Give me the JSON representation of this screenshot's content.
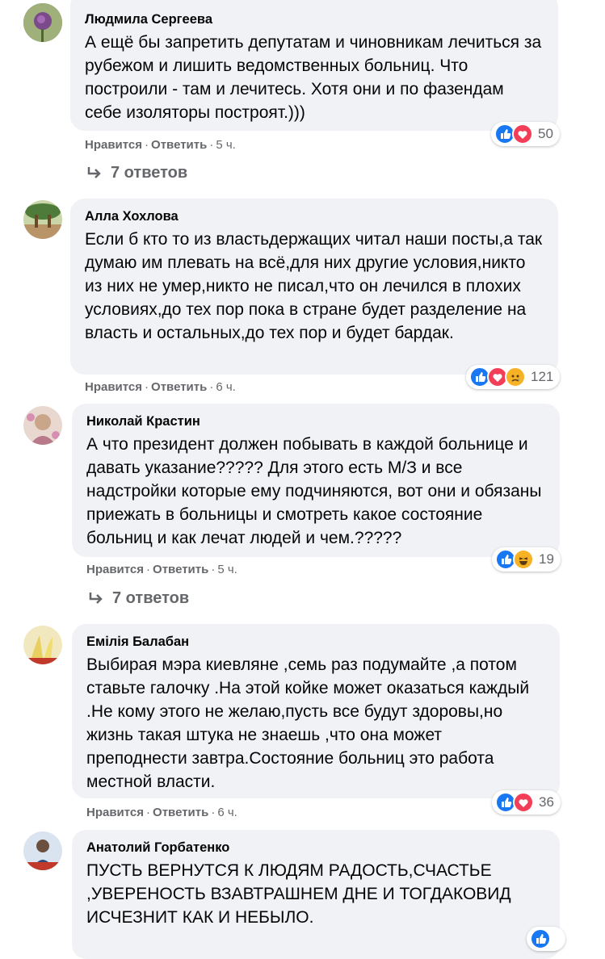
{
  "comments": [
    {
      "author": "Людмила Сергеева",
      "text": "А ещё бы запретить депутатам и чиновникам лечиться за рубежом и лишить ведомственных больниц. Что построили - там и лечитесь. Хотя они и по фазендам себе изоляторы построят.)))",
      "like_label": "Нравится",
      "reply_label": "Ответить",
      "time": "5 ч.",
      "reaction_count": "50",
      "reactions": [
        "like-icon",
        "love-icon"
      ],
      "replies_label": "7 ответов"
    },
    {
      "author": "Алла Хохлова",
      "text": "Если б кто то из властьдержащих читал наши посты,а так думаю им плевать на всё,для них другие условия,никто из них не умер,никто не писал,что он лечился в плохих условиях,до тех пор пока в стране будет разделение на власть и остальных,до тех пор и будет бардак.",
      "like_label": "Нравится",
      "reply_label": "Ответить",
      "time": "6 ч.",
      "reaction_count": "121",
      "reactions": [
        "like-icon",
        "love-icon",
        "sad-icon"
      ]
    },
    {
      "author": "Николай Крастин",
      "text": "А что президент должен побывать в каждой больнице и давать указание????? Для этого есть М/З и все надстройки которые ему подчиняются, вот они и обязаны приежать в больницы и смотреть какое состояние больниц и как лечат людей и чем.?????",
      "like_label": "Нравится",
      "reply_label": "Ответить",
      "time": "5 ч.",
      "reaction_count": "19",
      "reactions": [
        "like-icon",
        "haha-icon"
      ],
      "replies_label": "7 ответов"
    },
    {
      "author": "Емілія Балабан",
      "text": "Выбирая мэра киевляне ,семь раз подумайте ,а потом ставьте галочку .На этой койке может оказаться каждый .Не кому этого не желаю,пусть все будут здоровы,но жизнь такая штука не знаешь ,что она может преподнести завтра.Состояние больниц это работа местной власти.",
      "like_label": "Нравится",
      "reply_label": "Ответить",
      "time": "6 ч.",
      "reaction_count": "36",
      "reactions": [
        "like-icon",
        "love-icon"
      ]
    },
    {
      "author": "Анатолий Горбатенко",
      "text": "ПУСТЬ ВЕРНУТСЯ К ЛЮДЯМ РАДОСТЬ,СЧАСТЬЕ ,УВЕРЕНОСТЬ ВЗАВТРАШНЕМ ДНЕ И ТОГДАКОВИД ИСЧЕЗНИТ КАК И НЕБЫЛО.",
      "reactions": [
        "like-icon"
      ]
    }
  ],
  "separator": "·",
  "colors": {
    "bubble": "#f0f2f5",
    "like_blue": "#1877f2",
    "love_red": "#f33e58",
    "haha_yellow": "#f7b125",
    "meta_gray": "#65676b"
  }
}
